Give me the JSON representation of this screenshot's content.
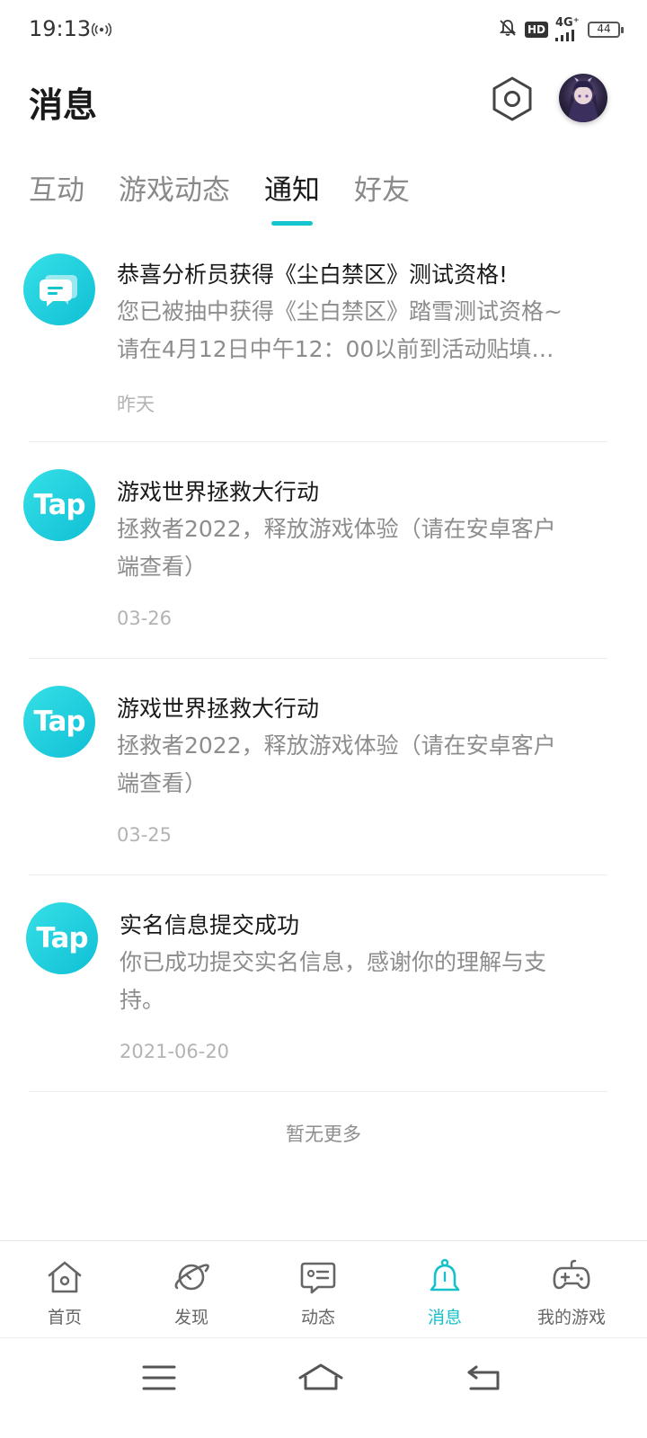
{
  "status_bar": {
    "time": "19:13",
    "network": "4G⁺",
    "battery": "44"
  },
  "header": {
    "title": "消息"
  },
  "tabs": [
    {
      "label": "互动",
      "active": false
    },
    {
      "label": "游戏动态",
      "active": false
    },
    {
      "label": "通知",
      "active": true
    },
    {
      "label": "好友",
      "active": false
    }
  ],
  "notifications": [
    {
      "icon": "chat-bubble-icon",
      "title": "恭喜分析员获得《尘白禁区》测试资格!",
      "body_lines": [
        "您已被抽中获得《尘白禁区》踏雪测试资格~",
        "请在4月12日中午12：00以前到活动贴填…"
      ],
      "time": "昨天"
    },
    {
      "icon": "tap-logo-icon",
      "icon_text": "Tap",
      "title": "游戏世界拯救大行动",
      "body_lines": [
        "拯救者2022，释放游戏体验（请在安卓客户",
        "端查看）"
      ],
      "time": "03-26"
    },
    {
      "icon": "tap-logo-icon",
      "icon_text": "Tap",
      "title": "游戏世界拯救大行动",
      "body_lines": [
        "拯救者2022，释放游戏体验（请在安卓客户",
        "端查看）"
      ],
      "time": "03-25"
    },
    {
      "icon": "tap-logo-icon",
      "icon_text": "Tap",
      "title": "实名信息提交成功",
      "body_lines": [
        "你已成功提交实名信息，感谢你的理解与支",
        "持。"
      ],
      "time": "2021-06-20"
    }
  ],
  "footer_text": "暂无更多",
  "bottom_nav": [
    {
      "label": "首页",
      "icon": "home-icon",
      "active": false
    },
    {
      "label": "发现",
      "icon": "planet-icon",
      "active": false
    },
    {
      "label": "动态",
      "icon": "feed-icon",
      "active": false
    },
    {
      "label": "消息",
      "icon": "bell-icon",
      "active": true
    },
    {
      "label": "我的游戏",
      "icon": "gamepad-icon",
      "active": false
    }
  ],
  "colors": {
    "accent": "#15c5ce",
    "inactive_text": "#8a8a8a"
  }
}
